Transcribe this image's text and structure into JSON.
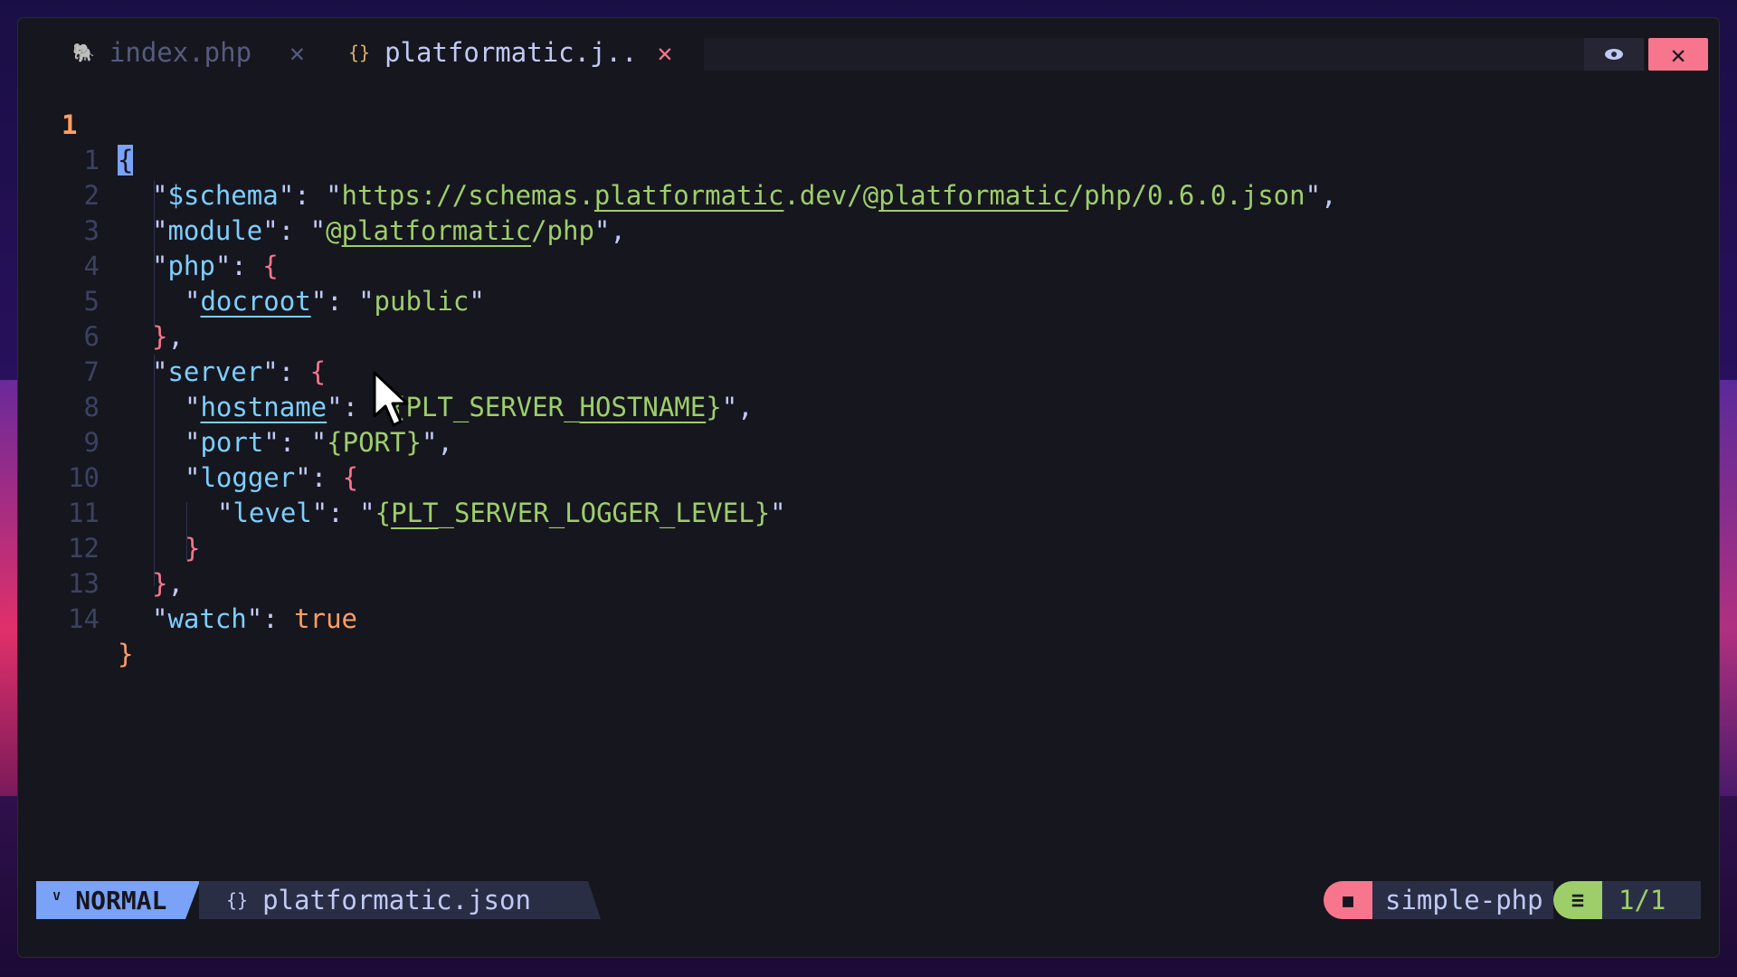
{
  "tabs": [
    {
      "label": "index.php",
      "icon": "elephant-icon",
      "active": false
    },
    {
      "label": "platformatic.j..",
      "icon": "braces-icon",
      "active": true
    }
  ],
  "editor": {
    "current_line_number": "1",
    "lines": [
      {
        "n": "1",
        "text": "\"$schema\": \"https://schemas.platformatic.dev/@platformatic/php/0.6.0.json\","
      },
      {
        "n": "2",
        "text": "\"module\": \"@platformatic/php\","
      },
      {
        "n": "3",
        "text": "\"php\": {"
      },
      {
        "n": "4",
        "text": "\"docroot\": \"public\""
      },
      {
        "n": "5",
        "text": "},"
      },
      {
        "n": "6",
        "text": "\"server\": {"
      },
      {
        "n": "7",
        "text": "\"hostname\": \"{PLT_SERVER_HOSTNAME}\","
      },
      {
        "n": "8",
        "text": "\"port\": \"{PORT}\","
      },
      {
        "n": "9",
        "text": "\"logger\": {"
      },
      {
        "n": "10",
        "text": "\"level\": \"{PLT_SERVER_LOGGER_LEVEL}\""
      },
      {
        "n": "11",
        "text": "}"
      },
      {
        "n": "12",
        "text": "},"
      },
      {
        "n": "13",
        "text": "\"watch\": true"
      },
      {
        "n": "14",
        "text": "}"
      }
    ]
  },
  "statusbar": {
    "mode": "NORMAL",
    "file": "platformatic.json",
    "project": "simple-php",
    "position": "1/1"
  },
  "colors": {
    "accent_blue": "#7aa2f7",
    "red": "#f7768e",
    "green": "#9ece6a",
    "cyan": "#7dcfff",
    "orange": "#ff9e64",
    "background": "#16161e"
  }
}
